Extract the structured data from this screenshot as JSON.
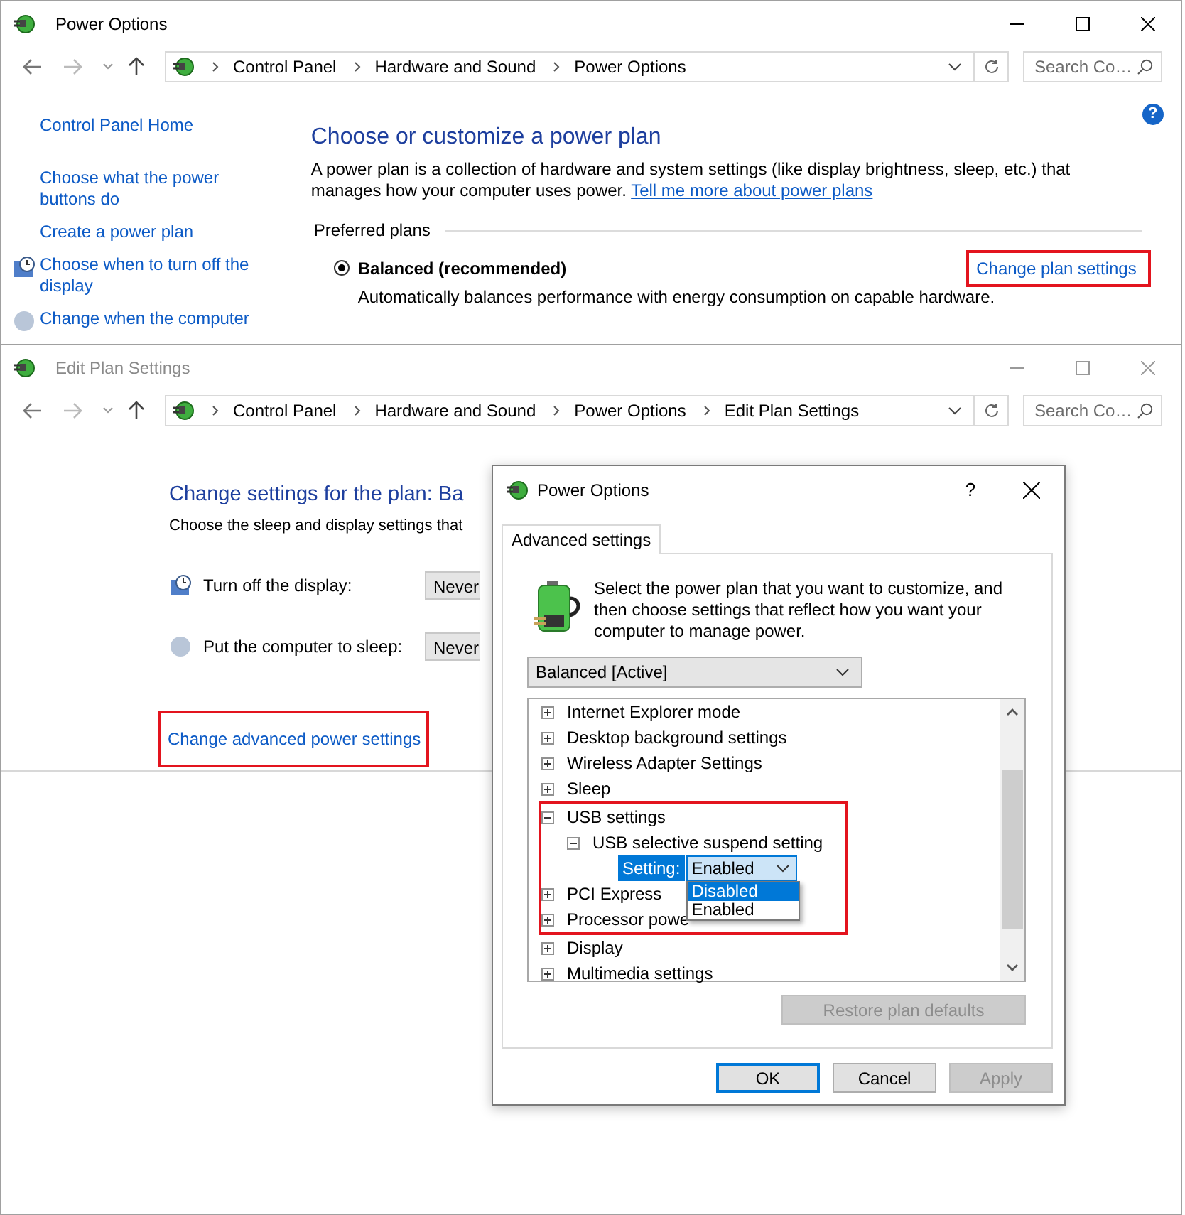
{
  "power_options_window": {
    "title": "Power Options",
    "active": true,
    "breadcrumb": [
      "Control Panel",
      "Hardware and Sound",
      "Power Options"
    ],
    "search": {
      "placeholder": "Search Co…"
    },
    "help": "?",
    "sidebar": {
      "items": [
        {
          "label": "Control Panel Home"
        },
        {
          "label": "Choose what the power buttons do"
        },
        {
          "label": "Create a power plan"
        },
        {
          "label": "Choose when to turn off the display"
        },
        {
          "label": "Change when the computer"
        }
      ]
    },
    "heading": "Choose or customize a power plan",
    "description": "A power plan is a collection of hardware and system settings (like display brightness, sleep, etc.) that manages how your computer uses power.",
    "learn_more_link": "Tell me more about power plans",
    "section_title": "Preferred plans",
    "plans": [
      {
        "name": "Balanced (recommended)",
        "selected": true,
        "description": "Automatically balances performance with energy consumption on capable hardware.",
        "link": "Change plan settings",
        "highlighted": true
      }
    ]
  },
  "edit_plan_window": {
    "title": "Edit Plan Settings",
    "active": false,
    "breadcrumb": [
      "Control Panel",
      "Hardware and Sound",
      "Power Options",
      "Edit Plan Settings"
    ],
    "search": {
      "placeholder": "Search Co…"
    },
    "heading": "Change settings for the plan: Ba",
    "subtitle": "Choose the sleep and display settings that",
    "settings": [
      {
        "label": "Turn off the display:",
        "value": "Never"
      },
      {
        "label": "Put the computer to sleep:",
        "value": "Never"
      }
    ],
    "advanced_link": {
      "label": "Change advanced power settings",
      "highlighted": true
    }
  },
  "dialog": {
    "title": "Power Options",
    "help": "?",
    "tabs": [
      {
        "label": "Advanced settings",
        "selected": true
      }
    ],
    "intro": "Select the power plan that you want to customize, and then choose settings that reflect how you want your computer to manage power.",
    "plan_select": "Balanced [Active]",
    "tree": [
      {
        "kind": "group",
        "label": "Internet Explorer mode",
        "expanded": false
      },
      {
        "kind": "group",
        "label": "Desktop background settings",
        "expanded": false
      },
      {
        "kind": "group",
        "label": "Wireless Adapter Settings",
        "expanded": false
      },
      {
        "kind": "group",
        "label": "Sleep",
        "expanded": false
      },
      {
        "kind": "highlight",
        "items": [
          {
            "kind": "group",
            "label": "USB settings",
            "expanded": true,
            "children": [
              {
                "kind": "group",
                "label": "USB selective suspend setting",
                "expanded": true,
                "children": [
                  {
                    "kind": "setting",
                    "label": "Setting:",
                    "value": "Enabled",
                    "open": true,
                    "options": [
                      {
                        "label": "Disabled",
                        "highlighted": true
                      },
                      {
                        "label": "Enabled",
                        "highlighted": false
                      }
                    ]
                  }
                ]
              }
            ]
          },
          {
            "kind": "group",
            "label": "PCI Express",
            "expanded": false
          },
          {
            "kind": "group",
            "label": "Processor powe",
            "expanded": false
          }
        ]
      },
      {
        "kind": "group",
        "label": "Display",
        "expanded": false
      },
      {
        "kind": "group",
        "label": "Multimedia settings",
        "expanded": false
      }
    ],
    "restore_button": {
      "label": "Restore plan defaults",
      "disabled": true
    },
    "buttons": [
      {
        "label": "OK",
        "default": true,
        "disabled": false
      },
      {
        "label": "Cancel",
        "default": false,
        "disabled": false
      },
      {
        "label": "Apply",
        "default": false,
        "disabled": true
      }
    ]
  }
}
